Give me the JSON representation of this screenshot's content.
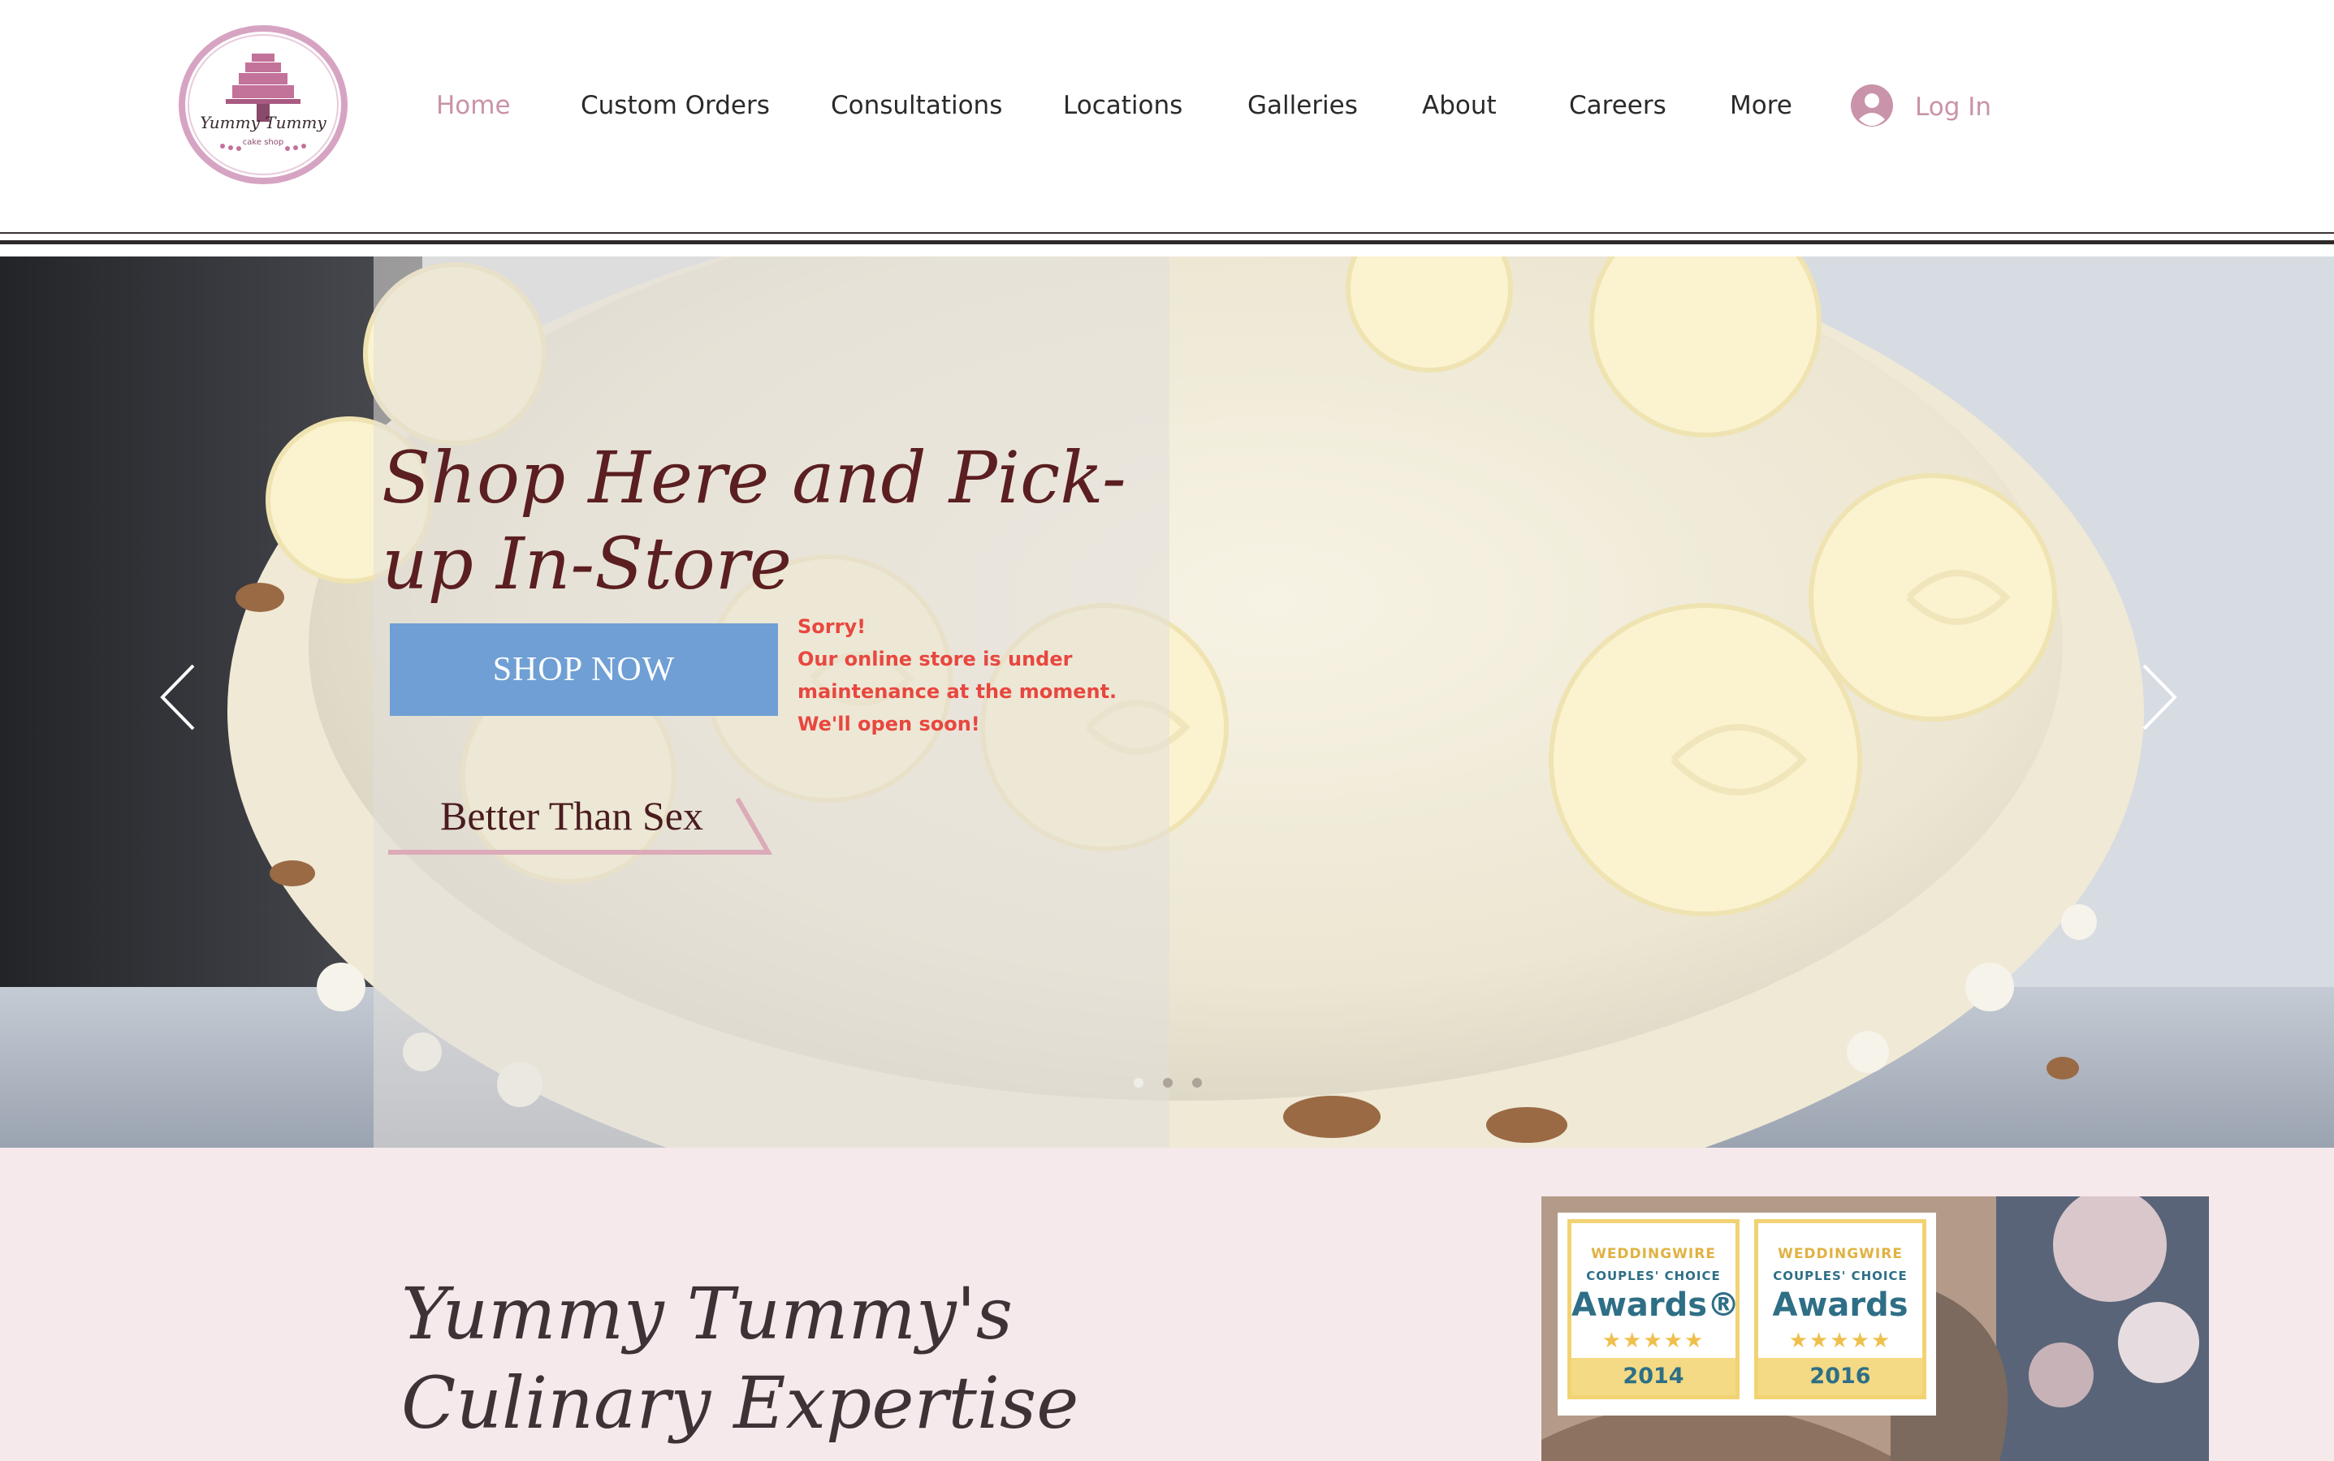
{
  "header": {
    "logo_text": "Yummy Tummy",
    "logo_subtext": "cake shop",
    "nav": [
      {
        "label": "Home",
        "active": true
      },
      {
        "label": "Custom Orders",
        "active": false
      },
      {
        "label": "Consultations",
        "active": false
      },
      {
        "label": "Locations",
        "active": false
      },
      {
        "label": "Galleries",
        "active": false
      },
      {
        "label": "About",
        "active": false
      },
      {
        "label": "Careers",
        "active": false
      },
      {
        "label": "More",
        "active": false
      }
    ],
    "login_label": "Log In",
    "accent_color": "#c993a9"
  },
  "hero": {
    "title": "Shop Here and Pick-up In-Store",
    "shop_button": "SHOP NOW",
    "notice": [
      "Sorry!",
      "Our online store is under",
      "maintenance at the moment.",
      "We'll open soon!"
    ],
    "flavor_label": "Better Than Sex",
    "slides": {
      "count": 3,
      "active_index": 0
    },
    "prev_icon": "chevron-left-icon",
    "next_icon": "chevron-right-icon",
    "colors": {
      "title": "#5b1e21",
      "button": "#6f9fd4",
      "notice": "#e8473f"
    }
  },
  "section": {
    "title": "Yummy Tummy's Culinary Expertise",
    "background": "#f5e9ec",
    "awards": [
      {
        "brand": "WEDDINGWIRE",
        "line": "COUPLES' CHOICE",
        "title": "Awards®",
        "stars": "★★★★★",
        "year": "2014"
      },
      {
        "brand": "WEDDINGWIRE",
        "line": "COUPLES' CHOICE",
        "title": "Awards",
        "stars": "★★★★★",
        "year": "2016"
      }
    ]
  }
}
